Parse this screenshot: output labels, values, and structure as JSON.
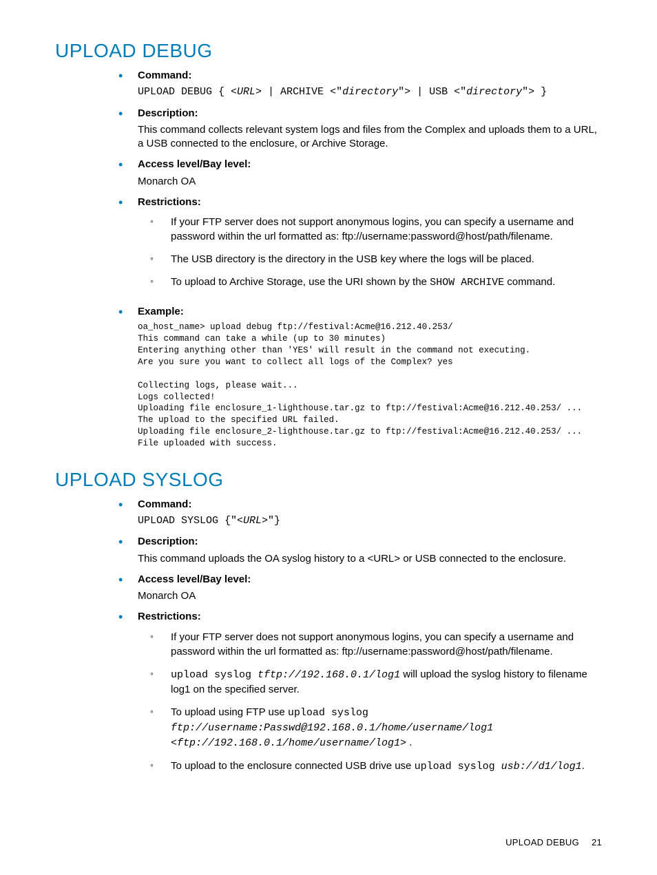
{
  "sections": [
    {
      "title": "UPLOAD DEBUG",
      "items": {
        "command_label": "Command:",
        "command_html": "UPLOAD DEBUG { <<i>URL</i>> | ARCHIVE <\"<i>directory</i>\"> | USB <\"<i>directory</i>\"> }",
        "description_label": "Description:",
        "description_text": "This command collects relevant system logs and files from the Complex and uploads them to a URL, a USB connected to the enclosure, or Archive Storage.",
        "access_label": "Access level/Bay level:",
        "access_text": "Monarch OA",
        "restrictions_label": "Restrictions:",
        "restrictions": [
          {
            "html": "If your FTP server does not support anonymous logins, you can specify a username and password within the url formatted as: ftp://username:password@host/path/filename."
          },
          {
            "html": "The USB directory is the directory in the USB key where the logs will be placed."
          },
          {
            "html": "To upload to Archive Storage, use the URI shown by the <span class=\"cmd\">SHOW ARCHIVE</span> command."
          }
        ],
        "example_label": "Example:",
        "example_text": "oa_host_name> upload debug ftp://festival:Acme@16.212.40.253/\nThis command can take a while (up to 30 minutes)\nEntering anything other than 'YES' will result in the command not executing.\nAre you sure you want to collect all logs of the Complex? yes\n\nCollecting logs, please wait...\nLogs collected!\nUploading file enclosure_1-lighthouse.tar.gz to ftp://festival:Acme@16.212.40.253/ ...\nThe upload to the specified URL failed.\nUploading file enclosure_2-lighthouse.tar.gz to ftp://festival:Acme@16.212.40.253/ ...\nFile uploaded with success."
      }
    },
    {
      "title": "UPLOAD SYSLOG",
      "items": {
        "command_label": "Command:",
        "command_html": "UPLOAD SYSLOG {\"<<i>URL</i>>\"}",
        "description_label": "Description:",
        "description_text": "This command uploads the OA syslog history to a <URL> or USB connected to the enclosure.",
        "access_label": "Access level/Bay level:",
        "access_text": "Monarch OA",
        "restrictions_label": "Restrictions:",
        "restrictions": [
          {
            "html": "If your FTP server does not support anonymous logins, you can specify a username and password within the url formatted as: ftp://username:password@host/path/filename."
          },
          {
            "html": "<span class=\"cmd\">upload syslog <i>tftp://192.168.0.1/log1</i></span> will upload the syslog history to filename log1 on the specified server."
          },
          {
            "html": "To upload using FTP use <span class=\"cmd\">upload syslog</span><br><span class=\"cmd\"><i>ftp://username:Passwd@192.168.0.1/home/username/log1</i></span><br><span class=\"cmd\"><i>&lt;ftp://192.168.0.1/home/username/log1&gt;</i></span> ."
          },
          {
            "html": "To upload to the enclosure connected USB drive use <span class=\"cmd\">upload syslog <i>usb://d1/log1</i></span>."
          }
        ]
      }
    }
  ],
  "footer": {
    "label": "UPLOAD DEBUG",
    "page": "21"
  }
}
